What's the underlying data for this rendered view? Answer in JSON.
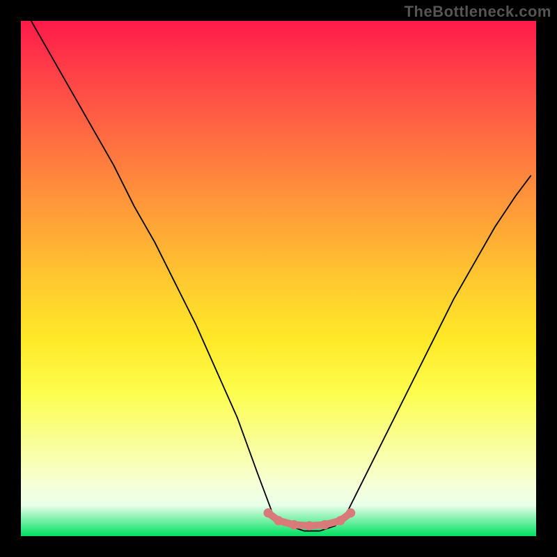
{
  "watermark": "TheBottleneck.com",
  "chart_data": {
    "type": "line",
    "title": "",
    "xlabel": "",
    "ylabel": "",
    "xlim": [
      0,
      100
    ],
    "ylim": [
      0,
      100
    ],
    "series": [
      {
        "name": "curve",
        "x": [
          2,
          6,
          10,
          14,
          18,
          22,
          26,
          30,
          34,
          38,
          42,
          46,
          49,
          52,
          55,
          58,
          61,
          63,
          65,
          68,
          72,
          76,
          80,
          84,
          88,
          92,
          96,
          99
        ],
        "values": [
          100,
          93,
          86,
          79,
          72,
          64,
          57,
          49,
          41,
          32,
          23,
          12,
          4,
          2,
          1,
          1,
          2,
          4,
          8,
          14,
          22,
          30,
          38,
          46,
          53,
          60,
          66,
          70
        ]
      }
    ],
    "flat_region": {
      "name": "highlighted-zone",
      "color": "#d97a7a",
      "points_x": [
        48,
        50,
        53,
        56,
        59,
        62,
        64
      ],
      "points_y": [
        4.5,
        3,
        2.2,
        2,
        2.2,
        3,
        4.5
      ]
    },
    "green_bands": [
      {
        "y": 99.6,
        "color": "#00e060"
      },
      {
        "y": 99.0,
        "color": "#3ee878"
      },
      {
        "y": 98.4,
        "color": "#72ef8e"
      },
      {
        "y": 97.8,
        "color": "#9af5a8"
      },
      {
        "y": 97.2,
        "color": "#bef9c2"
      }
    ]
  }
}
